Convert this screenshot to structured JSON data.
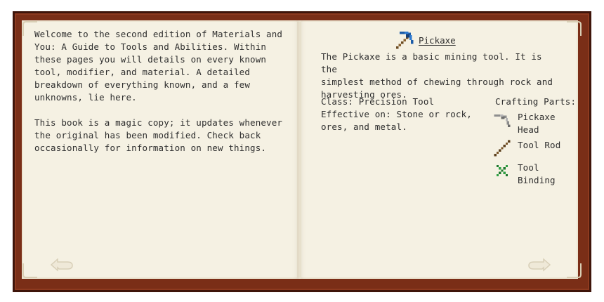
{
  "left_page": {
    "paragraph_1": "Welcome to the second edition of Materials and\nYou: A Guide to Tools and Abilities. Within\nthese pages you will details on every known\ntool, modifier, and material. A detailed\nbreakdown of everything known, and a few\nunknowns, lie here.",
    "paragraph_2": "This book is a magic copy; it updates whenever\nthe original has been modified. Check back\noccasionally for information on new things."
  },
  "right_page": {
    "title": "Pickaxe",
    "title_icon": "pickaxe-icon",
    "description": "The Pickaxe is a basic mining tool. It is the\nsimplest method of chewing through rock and\nharvesting ores.",
    "class_label": "Class: Precision Tool",
    "effective_label": "Effective on: Stone or rock,\nores, and metal.",
    "crafting_parts_title": "Crafting Parts:",
    "parts": [
      {
        "label": "Pickaxe\nHead",
        "icon": "pickaxe-head-icon"
      },
      {
        "label": "Tool Rod",
        "icon": "tool-rod-icon"
      },
      {
        "label": "Tool\nBinding",
        "icon": "tool-binding-icon"
      }
    ]
  },
  "navigation": {
    "previous_icon": "previous-page-arrow-icon",
    "next_icon": "next-page-arrow-icon"
  },
  "colors": {
    "cover": "#7a2e17",
    "cover_edge": "#3e140a",
    "page": "#f5f1e3",
    "text": "#2e2e2e"
  }
}
